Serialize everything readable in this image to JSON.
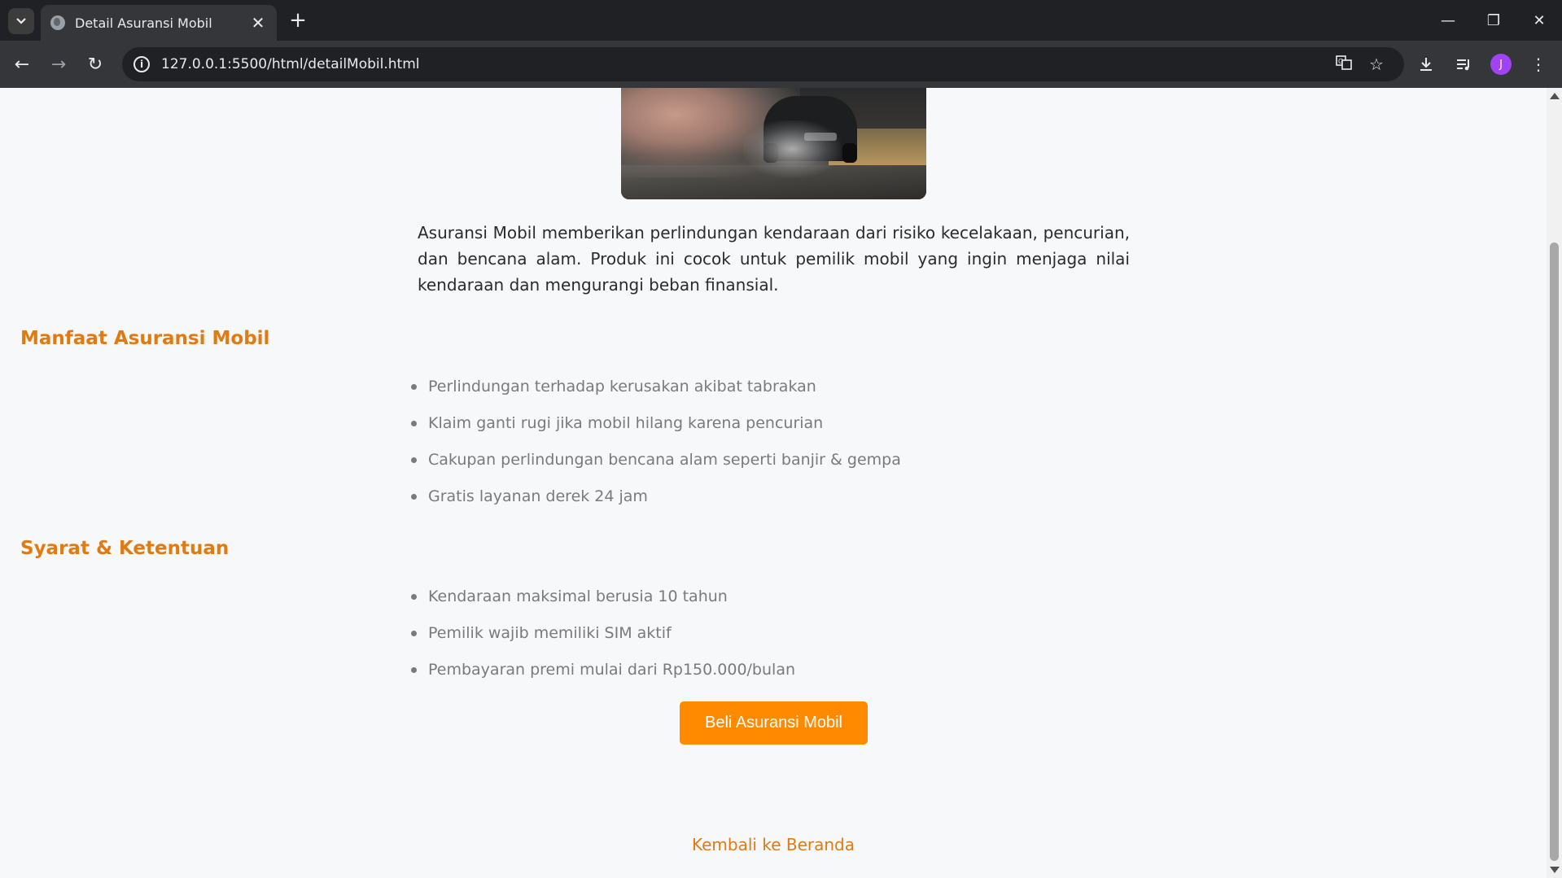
{
  "browser": {
    "tab_title": "Detail Asuransi Mobil",
    "tab_close": "✕",
    "new_tab": "+",
    "url": "127.0.0.1:5500/html/detailMobil.html",
    "profile_initial": "J",
    "window_controls": {
      "minimize": "—",
      "restore": "❐",
      "close": "✕"
    },
    "nav": {
      "back": "←",
      "forward": "→",
      "reload": "↻"
    },
    "icons": {
      "tab_search": "chevron-down-icon",
      "translate": "translate-icon",
      "bookmark": "star-icon",
      "download": "download-icon",
      "media": "media-control-icon",
      "menu": "kebab-menu-icon"
    }
  },
  "page": {
    "hero_image_alt": "car-drifting-image",
    "description": "Asuransi Mobil memberikan perlindungan kendaraan dari risiko kecelakaan, pencurian, dan bencana alam. Produk ini cocok untuk pemilik mobil yang ingin menjaga nilai kendaraan dan mengurangi beban finansial.",
    "benefits": {
      "title": "Manfaat Asuransi Mobil",
      "items": [
        "Perlindungan terhadap kerusakan akibat tabrakan",
        "Klaim ganti rugi jika mobil hilang karena pencurian",
        "Cakupan perlindungan bencana alam seperti banjir & gempa",
        "Gratis layanan derek 24 jam"
      ]
    },
    "terms": {
      "title": "Syarat & Ketentuan",
      "items": [
        "Kendaraan maksimal berusia 10 tahun",
        "Pemilik wajib memiliki SIM aktif",
        "Pembayaran premi mulai dari Rp150.000/bulan"
      ]
    },
    "buy_button": "Beli Asuransi Mobil",
    "back_link": "Kembali ke Beranda"
  },
  "colors": {
    "accent": "#e37a10",
    "button": "#ff8a00",
    "page_bg": "#f7f8fa"
  }
}
